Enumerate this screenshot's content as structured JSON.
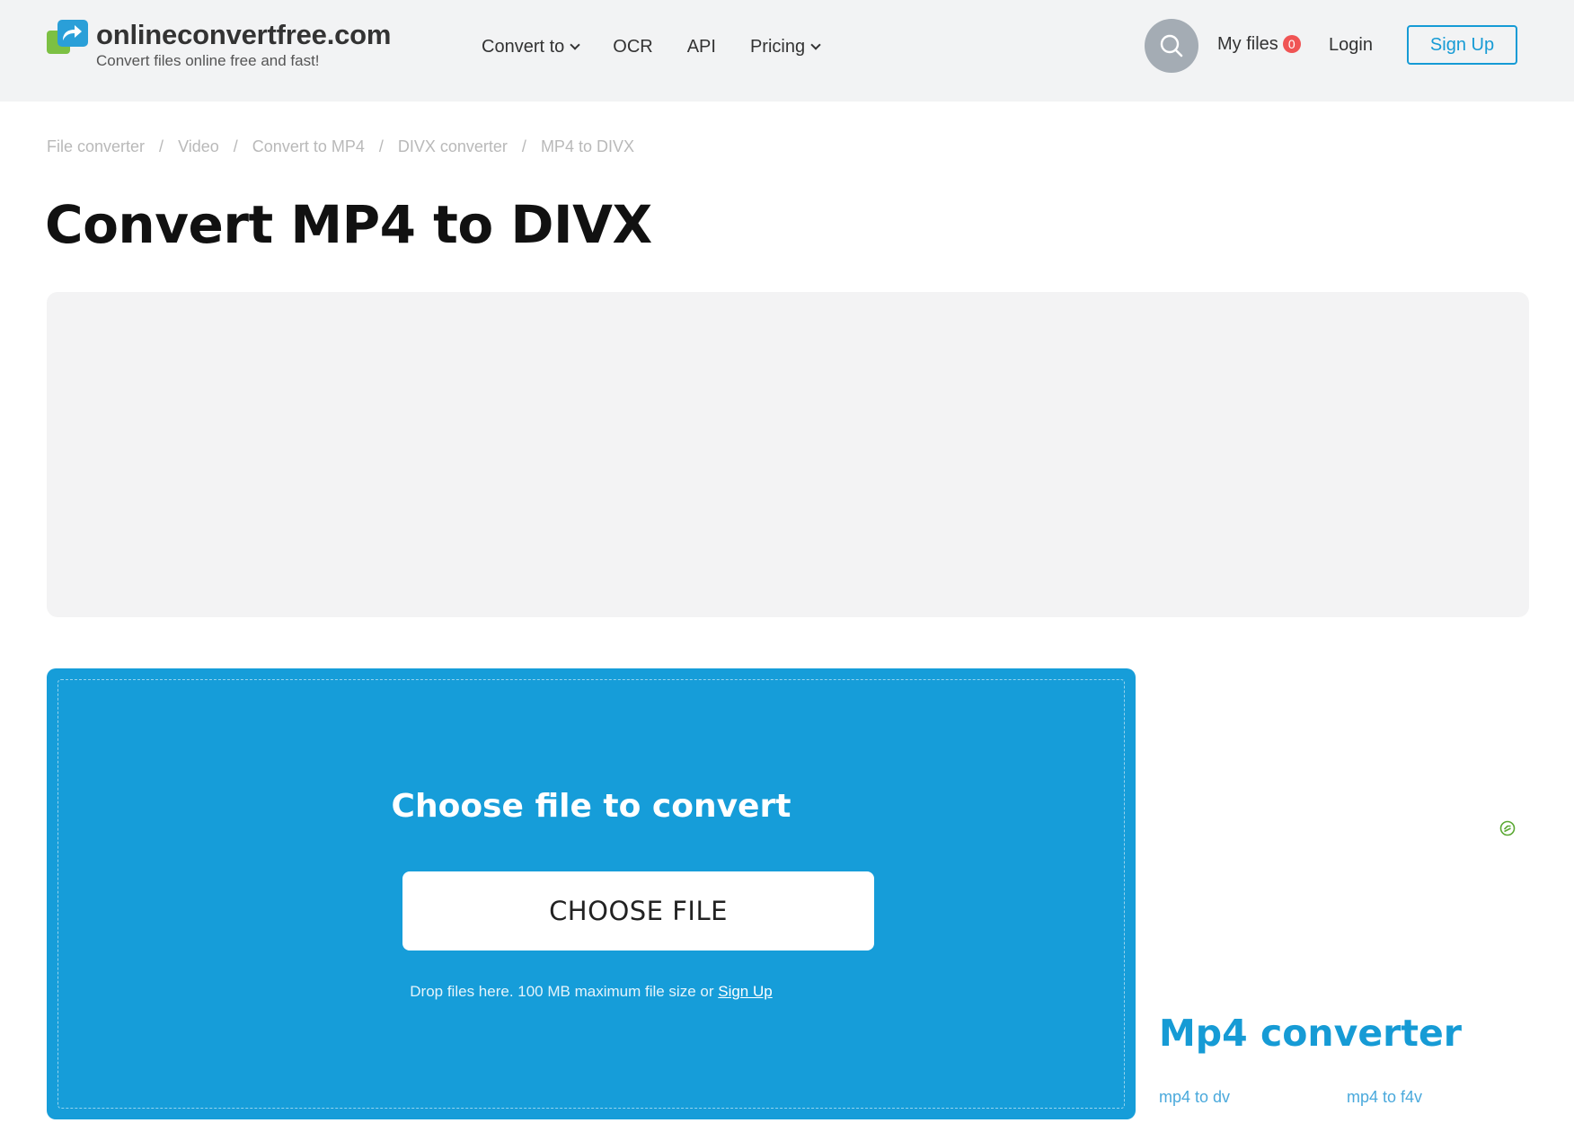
{
  "header": {
    "logo_title": "onlineconvertfree.com",
    "logo_tagline": "Convert files online free and fast!",
    "nav": [
      {
        "label": "Convert to",
        "has_dropdown": true
      },
      {
        "label": "OCR",
        "has_dropdown": false
      },
      {
        "label": "API",
        "has_dropdown": false
      },
      {
        "label": "Pricing",
        "has_dropdown": true
      }
    ],
    "search_icon": "search-icon",
    "my_files_label": "My files",
    "my_files_count": "0",
    "login_label": "Login",
    "signup_label": "Sign Up"
  },
  "breadcrumb": [
    "File converter",
    "Video",
    "Convert to MP4",
    "DIVX converter",
    "MP4 to DIVX"
  ],
  "breadcrumb_separator": "/",
  "page_title": "Convert MP4 to DIVX",
  "upload": {
    "title": "Choose file to convert",
    "button_label": "CHOOSE FILE",
    "drop_note": "Drop files here. 100 MB maximum file size or",
    "drop_note_link": "Sign Up"
  },
  "sidebar": {
    "title": "Mp4 converter",
    "links": [
      "mp4 to dv",
      "mp4 to f4v"
    ]
  },
  "colors": {
    "accent": "#169bd5",
    "upload_bg": "#169dd9",
    "header_bg": "#f2f3f4",
    "badge": "#f05454"
  }
}
